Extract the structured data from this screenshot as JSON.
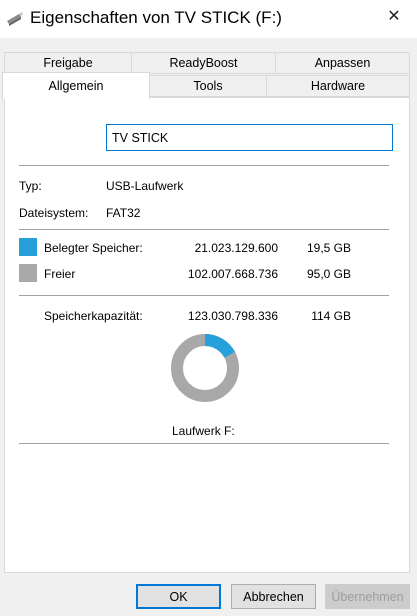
{
  "window": {
    "title": "Eigenschaften von TV STICK (F:)",
    "icon": "usb-drive-icon",
    "close_glyph": "✕"
  },
  "tabs_row1": [
    {
      "label": "Freigabe"
    },
    {
      "label": "ReadyBoost"
    },
    {
      "label": "Anpassen"
    }
  ],
  "tabs_row2": [
    {
      "label": "Allgemein",
      "active": true
    },
    {
      "label": "Tools"
    },
    {
      "label": "Hardware"
    }
  ],
  "general": {
    "name_value": "TV STICK",
    "type_label": "Typ:",
    "type_value": "USB-Laufwerk",
    "fs_label": "Dateisystem:",
    "fs_value": "FAT32",
    "used": {
      "label": "Belegter Speicher:",
      "bytes": "21.023.129.600",
      "size": "19,5 GB",
      "color": "#26a0da"
    },
    "free": {
      "label": "Freier",
      "bytes": "102.007.668.736",
      "size": "95,0 GB",
      "color": "#a8a8a8"
    },
    "capacity": {
      "label": "Speicherkapazität:",
      "bytes": "123.030.798.336",
      "size": "114 GB"
    },
    "used_fraction": 0.171,
    "drive_label": "Laufwerk F:"
  },
  "buttons": {
    "ok": "OK",
    "cancel": "Abbrechen",
    "apply": "Übernehmen"
  }
}
